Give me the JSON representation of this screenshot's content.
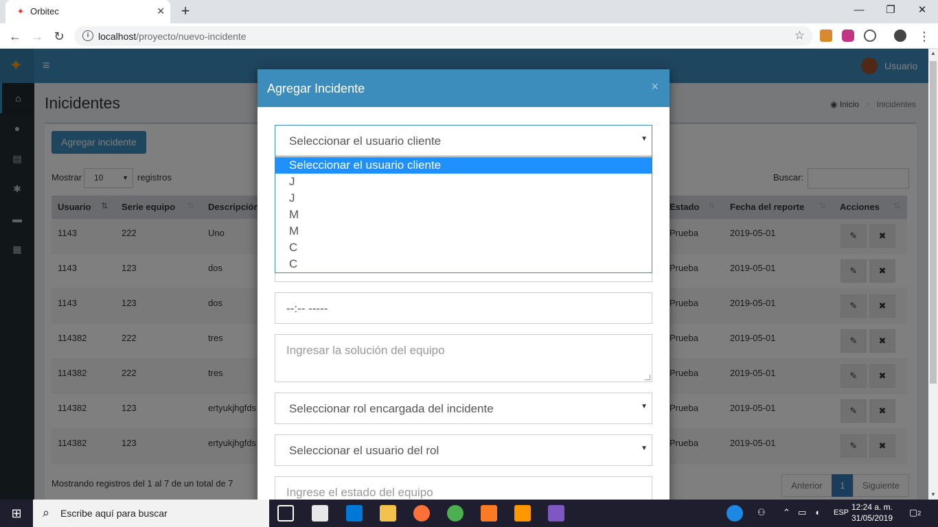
{
  "browser": {
    "tab_title": "Orbitec",
    "url_host": "localhost",
    "url_path": "/proyecto/nuevo-incidente"
  },
  "header": {
    "user_label": "Usuario"
  },
  "page": {
    "title": "Inicidentes",
    "breadcrumb_home": "Inicio",
    "breadcrumb_current": "Inicidentes"
  },
  "toolbar": {
    "add_button": "Agregar incidente",
    "show_label": "Mostrar",
    "page_length": "10",
    "show_suffix": "registros",
    "search_label": "Buscar:"
  },
  "table": {
    "columns": [
      "Usuario",
      "Serie equipo",
      "Descripción",
      "Estado",
      "Fecha del reporte",
      "Acciones"
    ],
    "rows": [
      {
        "usuario": "1143",
        "serie": "222",
        "descripcion": "Uno",
        "estado": "Prueba",
        "fecha": "2019-05-01"
      },
      {
        "usuario": "1143",
        "serie": "123",
        "descripcion": "dos",
        "estado": "Prueba",
        "fecha": "2019-05-01"
      },
      {
        "usuario": "1143",
        "serie": "123",
        "descripcion": "dos",
        "estado": "Prueba",
        "fecha": "2019-05-01"
      },
      {
        "usuario": "114382",
        "serie": "222",
        "descripcion": "tres",
        "estado": "Prueba",
        "fecha": "2019-05-01"
      },
      {
        "usuario": "114382",
        "serie": "222",
        "descripcion": "tres",
        "estado": "Prueba",
        "fecha": "2019-05-01"
      },
      {
        "usuario": "114382",
        "serie": "123",
        "descripcion": "ertyukjhgfds",
        "estado": "Prueba",
        "fecha": "2019-05-01"
      },
      {
        "usuario": "114382",
        "serie": "123",
        "descripcion": "ertyukjhgfds",
        "estado": "Prueba",
        "fecha": "2019-05-01"
      }
    ]
  },
  "footer": {
    "info": "Mostrando registros del 1 al 7 de un total de 7",
    "prev": "Anterior",
    "page": "1",
    "next": "Siguiente"
  },
  "modal": {
    "title": "Agregar Incidente",
    "close": "×",
    "client_select": "Seleccionar el usuario cliente",
    "client_options": [
      "Seleccionar el usuario cliente",
      "J",
      "J",
      "M",
      "M",
      "C",
      "C"
    ],
    "time_placeholder": "--:-- -----",
    "solution_placeholder": "Ingresar la solución del equipo",
    "role_select": "Seleccionar rol encargada del incidente",
    "role_user_select": "Seleccionar el usuario del rol",
    "state_placeholder": "Ingrese el estado del equipo"
  },
  "taskbar": {
    "search_text": "Escribe aquí para buscar",
    "lang": "ESP",
    "time": "12:24 a. m.",
    "date": "31/05/2019",
    "notif_count": "2"
  }
}
